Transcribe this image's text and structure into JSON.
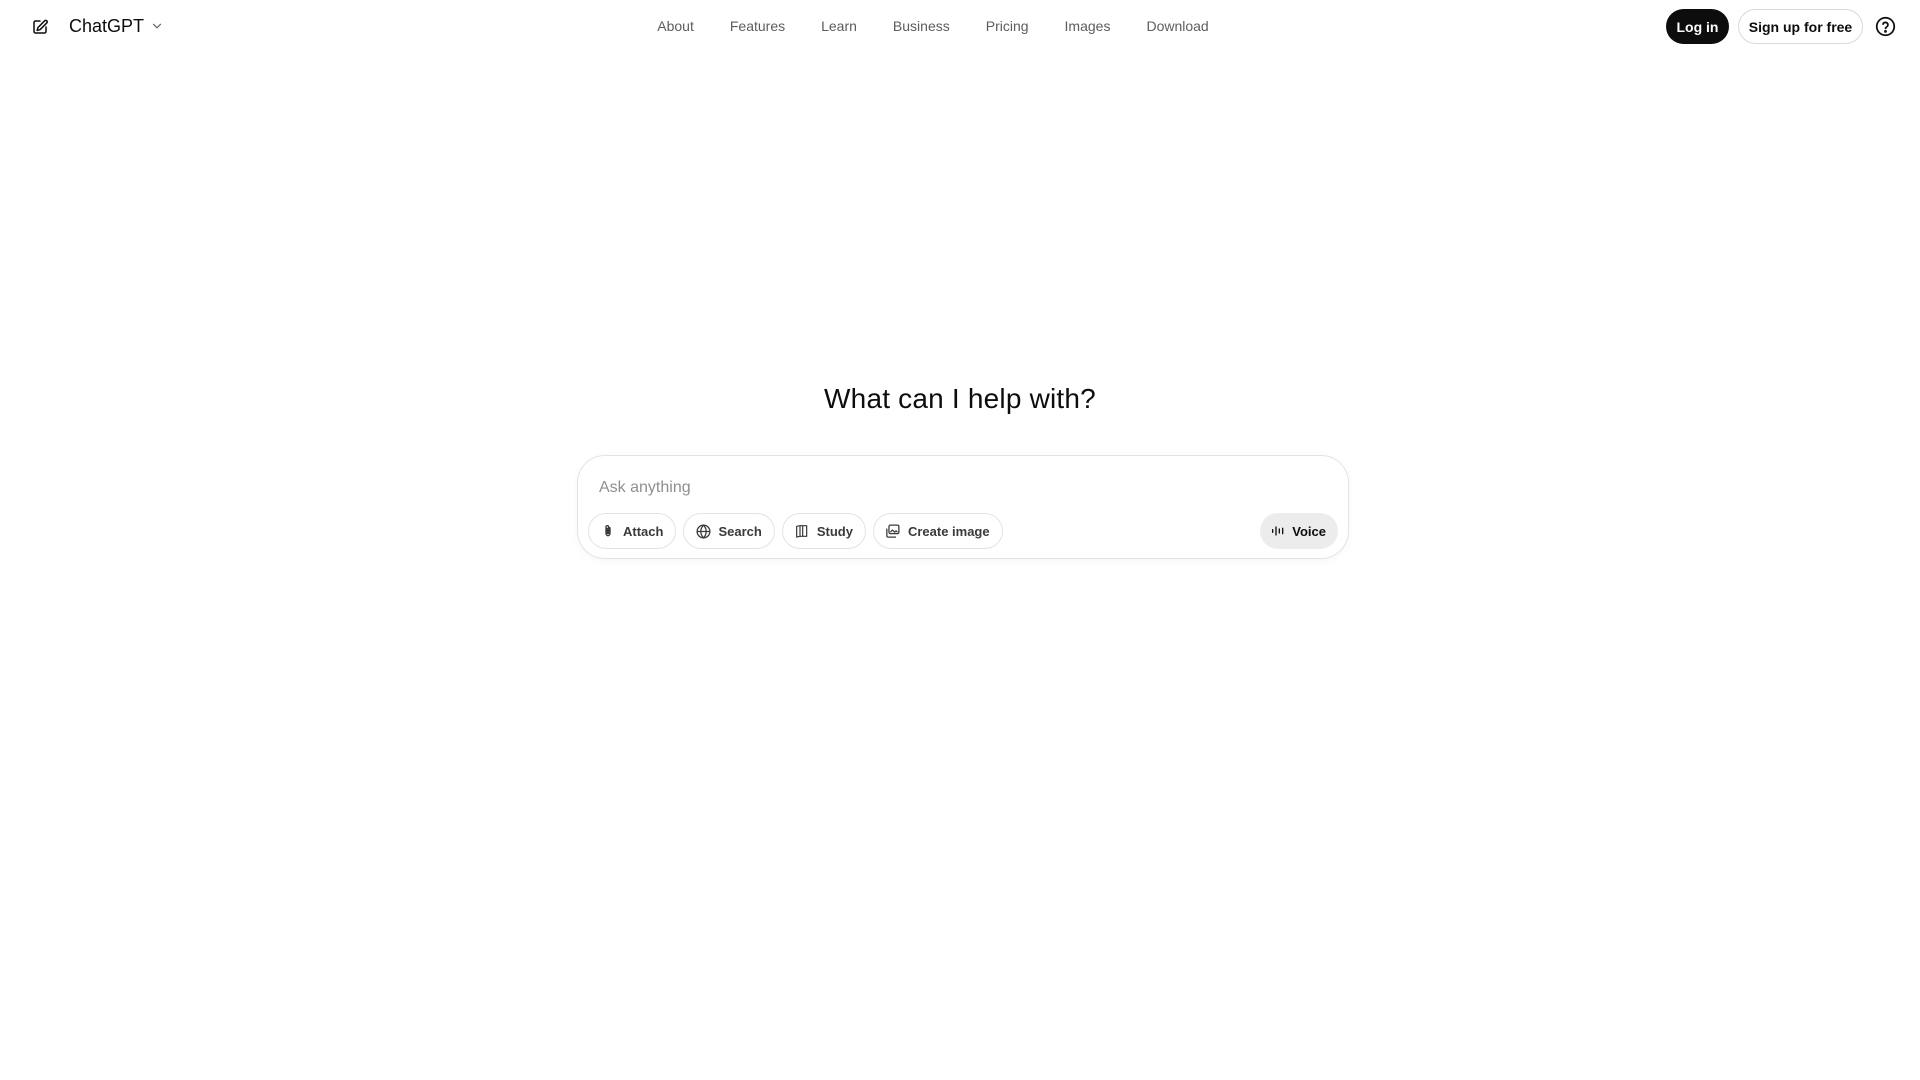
{
  "header": {
    "model_name": "ChatGPT",
    "nav": [
      "About",
      "Features",
      "Learn",
      "Business",
      "Pricing",
      "Images",
      "Download"
    ],
    "login_label": "Log in",
    "signup_label": "Sign up for free"
  },
  "main": {
    "headline": "What can I help with?",
    "composer": {
      "placeholder": "Ask anything",
      "tools": {
        "attach": "Attach",
        "search": "Search",
        "study": "Study",
        "create_image": "Create image"
      },
      "voice_label": "Voice"
    }
  },
  "icons": {
    "new_chat": "edit-icon",
    "model_chevron": "chevron-down-icon",
    "help": "help-circle-icon",
    "attach": "paperclip-icon",
    "search": "globe-icon",
    "study": "book-icon",
    "create_image": "image-icon",
    "voice": "waveform-icon"
  },
  "colors": {
    "primary_button": "#0d0d0d",
    "nav_text": "#5d5d5d",
    "placeholder": "#8f8f8f",
    "voice_bg": "#ececec"
  }
}
